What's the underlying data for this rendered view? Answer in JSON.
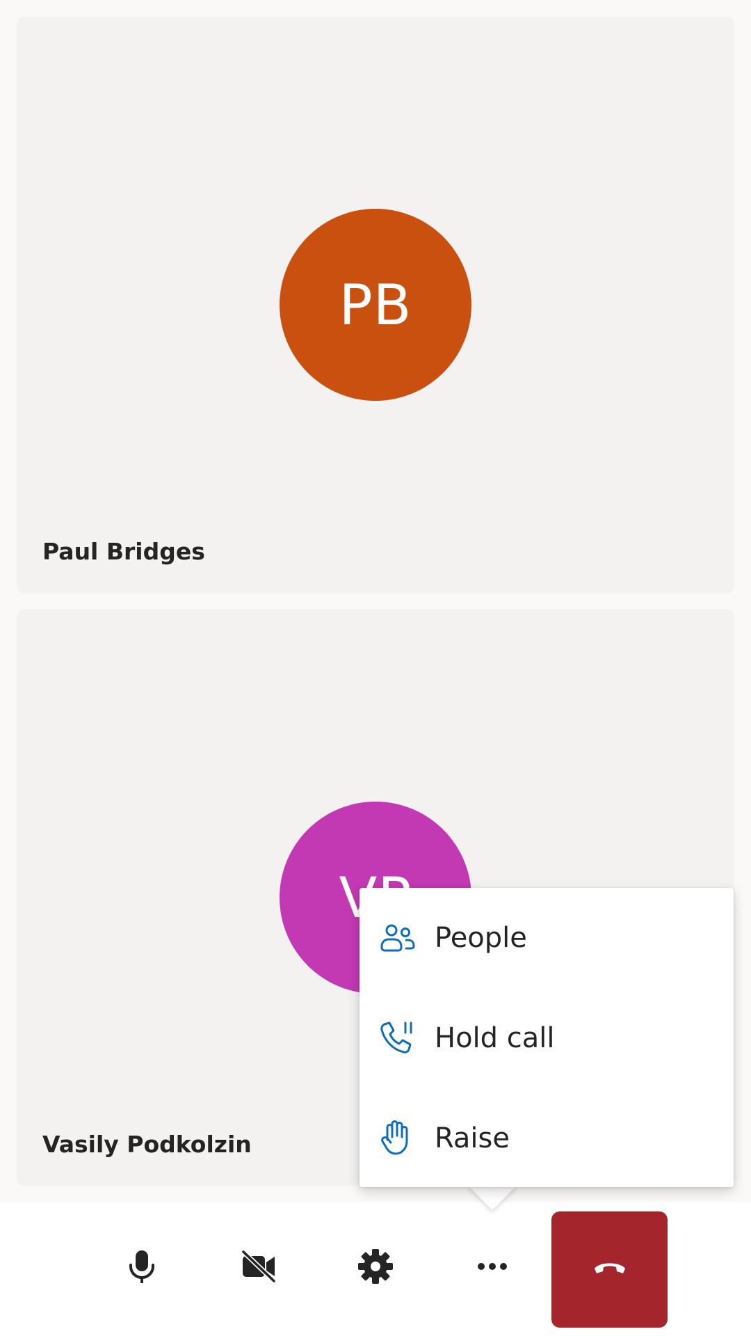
{
  "participants": [
    {
      "initials": "PB",
      "name": "Paul Bridges",
      "avatar_color": "#ca5010"
    },
    {
      "initials": "VP",
      "name": "Vasily Podkolzin",
      "avatar_color": "#c239b3"
    }
  ],
  "menu": {
    "items": [
      {
        "label": "People",
        "icon": "people-icon"
      },
      {
        "label": "Hold call",
        "icon": "hold-call-icon"
      },
      {
        "label": "Raise",
        "icon": "raise-hand-icon"
      }
    ]
  },
  "toolbar": {
    "buttons": [
      {
        "icon": "microphone-icon"
      },
      {
        "icon": "camera-off-icon"
      },
      {
        "icon": "gear-icon"
      },
      {
        "icon": "more-options-icon"
      }
    ],
    "end_call": {
      "icon": "hang-up-icon",
      "color": "#a4262c"
    }
  },
  "accent_color": "#0f6cbd"
}
